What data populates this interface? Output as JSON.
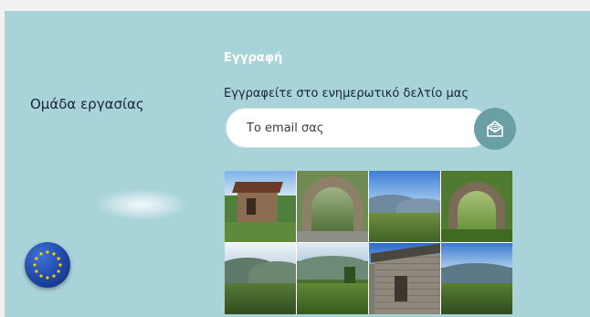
{
  "sidebar": {
    "team_link": "Ομάδα εργασίας",
    "flag_icon": "eu-flag-icon"
  },
  "registration": {
    "title": "Εγγραφή",
    "subtitle": "Εγγραφείτε στο ενημερωτικό δελτίο μας",
    "email_placeholder": "Το email σας",
    "send_icon": "envelope-icon"
  },
  "gallery": {
    "photos": [
      {
        "subject": "stone-house"
      },
      {
        "subject": "stone-bridge"
      },
      {
        "subject": "mountain-valley"
      },
      {
        "subject": "stone-arch"
      },
      {
        "subject": "mountain-range"
      },
      {
        "subject": "forest-valley"
      },
      {
        "subject": "stone-chapel"
      },
      {
        "subject": "mountain-view"
      }
    ]
  },
  "colors": {
    "panel": "#a8d3d9",
    "title": "#ffffff",
    "text": "#15243a",
    "send_button": "#6b9fa6",
    "eu_blue": "#1f47a5",
    "eu_gold": "#ffcc00"
  }
}
